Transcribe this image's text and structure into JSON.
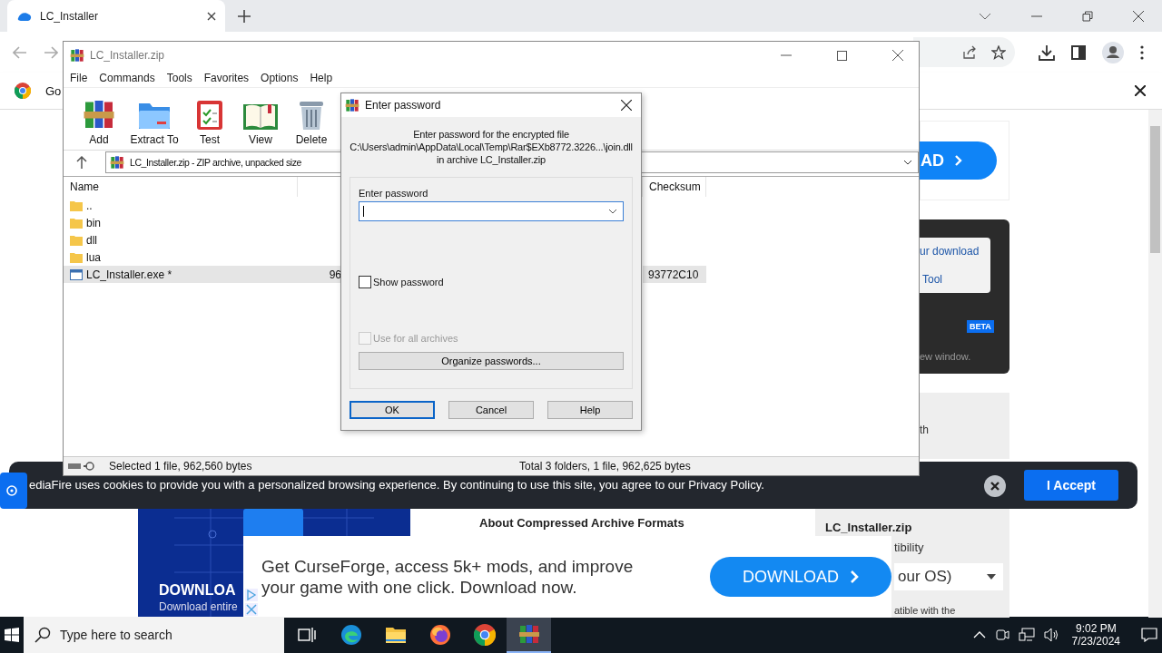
{
  "browser": {
    "tabs": [
      {
        "title": "LC_Installer",
        "selected": true
      }
    ],
    "infobar_text": "Go"
  },
  "webpage": {
    "top_button": "AD",
    "menu_links": [
      "ur download",
      "Tool"
    ],
    "beta_badge": "BETA",
    "panel_note": "ew window.",
    "fragment": "th",
    "section_title": "About Compressed Archive Formats",
    "promo_title": "DOWNLOA",
    "promo_text": "Download entire",
    "sidebar": {
      "title": "LC_Installer.zip",
      "label": "tibility",
      "select": "our OS)",
      "note": "atible with the"
    }
  },
  "winrar": {
    "title": "LC_Installer.zip",
    "menu": [
      "File",
      "Commands",
      "Tools",
      "Favorites",
      "Options",
      "Help"
    ],
    "toolbar": [
      {
        "label": "Add",
        "kind": "add"
      },
      {
        "label": "Extract To",
        "kind": "extract"
      },
      {
        "label": "Test",
        "kind": "test"
      },
      {
        "label": "View",
        "kind": "view"
      },
      {
        "label": "Delete",
        "kind": "delete"
      }
    ],
    "address": "LC_Installer.zip - ZIP archive, unpacked size",
    "columns": [
      {
        "label": "Name",
        "kind": "name"
      },
      {
        "label": "Checksum",
        "kind": "checksum"
      }
    ],
    "rows": [
      {
        "name": "..",
        "kind": "folder",
        "selected": false
      },
      {
        "name": "bin",
        "kind": "folder",
        "selected": false
      },
      {
        "name": "dll",
        "kind": "folder",
        "selected": false
      },
      {
        "name": "lua",
        "kind": "folder",
        "selected": false
      },
      {
        "name": "LC_Installer.exe *",
        "kind": "file",
        "size": "96",
        "checksum": "93772C10",
        "selected": true
      }
    ],
    "status": [
      "Selected 1 file, 962,560 bytes",
      "Total 3 folders, 1 file, 962,625 bytes"
    ]
  },
  "dialog": {
    "title": "Enter password",
    "message": [
      "Enter password for the encrypted file",
      "C:\\Users\\admin\\AppData\\Local\\Temp\\Rar$EXb8772.3226...\\join.dll",
      "in archive LC_Installer.zip"
    ],
    "field_label": "Enter password",
    "options": [
      {
        "label": "Show password",
        "checked": false,
        "disabled": false
      },
      {
        "label": "Use for all archives",
        "checked": false,
        "disabled": true
      }
    ],
    "organize_button": "Organize passwords...",
    "buttons": [
      {
        "label": "OK",
        "default": true
      },
      {
        "label": "Cancel",
        "default": false
      },
      {
        "label": "Help",
        "default": false
      }
    ]
  },
  "cookie_banner": {
    "text": "ediaFire uses cookies to provide you with a personalized browsing experience. By continuing to use this site, you agree to our Privacy Policy.",
    "accept": "I Accept"
  },
  "ad": {
    "text": [
      "Get CurseForge, access 5k+ mods, and improve",
      "your game with one click. Download now."
    ],
    "button": "DOWNLOAD"
  },
  "taskbar": {
    "search_placeholder": "Type here to search",
    "apps": [
      {
        "kind": "taskview",
        "active": false
      },
      {
        "kind": "edge",
        "active": false
      },
      {
        "kind": "explorer",
        "active": false
      },
      {
        "kind": "firefox",
        "active": false
      },
      {
        "kind": "chrome",
        "active": false
      },
      {
        "kind": "winrar",
        "active": true
      }
    ],
    "time": "9:02 PM",
    "date": "7/23/2024"
  }
}
